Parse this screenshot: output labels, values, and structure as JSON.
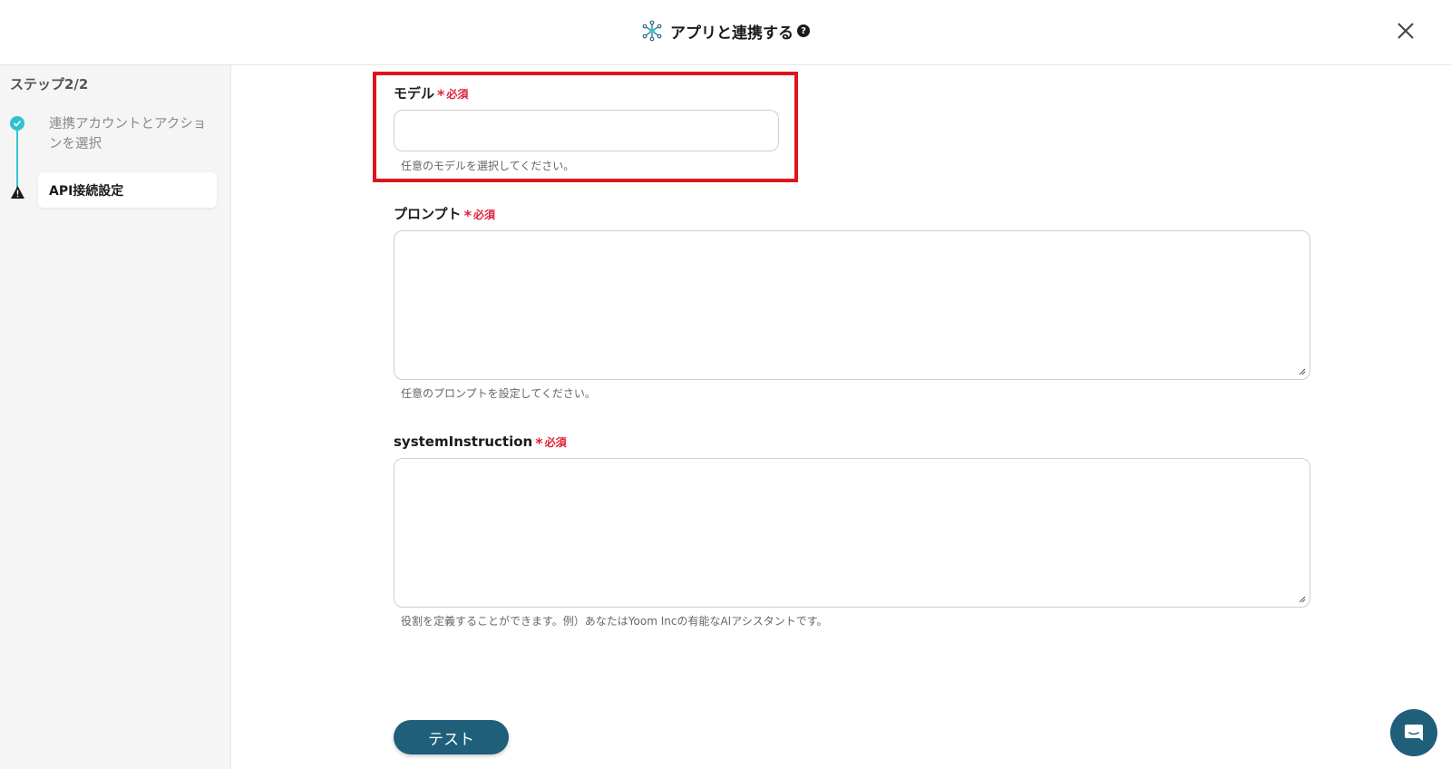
{
  "header": {
    "title": "アプリと連携する",
    "title_icon": "network-hub-icon",
    "help_icon": "help-circle-icon",
    "close_icon": "close-icon",
    "help_symbol": "?"
  },
  "sidebar": {
    "step_label": "ステップ2/2",
    "steps": [
      {
        "label": "連携アカウントとアクションを選択",
        "status": "completed",
        "icon": "check-circle-icon"
      },
      {
        "label": "API接続設定",
        "status": "active-warning",
        "icon": "warning-icon"
      }
    ]
  },
  "form": {
    "required_label": "必須",
    "model": {
      "label": "モデル",
      "value": "",
      "helper": "任意のモデルを選択してください。"
    },
    "prompt": {
      "label": "プロンプト",
      "value": "",
      "helper": "任意のプロンプトを設定してください。"
    },
    "system_instruction": {
      "label": "systemInstruction",
      "value": "",
      "helper": "役割を定義することができます。例）あなたはYoom Incの有能なAIアシスタントです。"
    }
  },
  "actions": {
    "test_label": "テスト",
    "chat_icon": "chat-bubble-icon"
  },
  "colors": {
    "accent_teal": "#2ec2cf",
    "primary_button": "#1f5f7a",
    "required_red": "#e0223a",
    "highlight_red": "#e0141b"
  }
}
